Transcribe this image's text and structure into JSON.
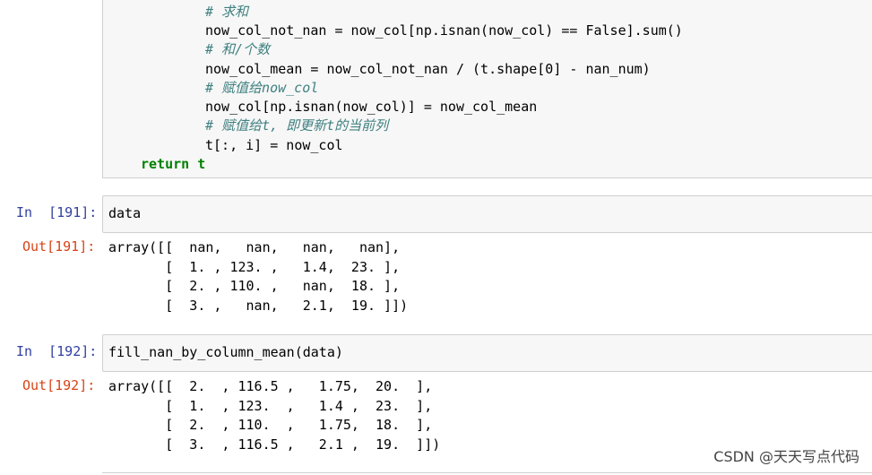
{
  "code_cell_190": {
    "lines": [
      {
        "type": "comment",
        "text": "# 求和"
      },
      {
        "type": "code",
        "text": "now_col_not_nan = now_col[np.isnan(now_col) == False].sum()"
      },
      {
        "type": "comment",
        "text": "# 和/个数"
      },
      {
        "type": "code",
        "text": "now_col_mean = now_col_not_nan / (t.shape[0] - nan_num)"
      },
      {
        "type": "comment",
        "text": "# 赋值给now_col"
      },
      {
        "type": "code",
        "text": "now_col[np.isnan(now_col)] = now_col_mean"
      },
      {
        "type": "comment",
        "text": "# 赋值给t, 即更新t的当前列"
      },
      {
        "type": "code",
        "text": "t[:, i] = now_col"
      },
      {
        "type": "return",
        "text": "return t"
      }
    ]
  },
  "cell_191": {
    "in_prompt": "In  [191]:",
    "input": "data",
    "out_prompt": "Out[191]:",
    "output_lines": [
      "array([[  nan,   nan,   nan,   nan],",
      "       [  1. , 123. ,   1.4,  23. ],",
      "       [  2. , 110. ,   nan,  18. ],",
      "       [  3. ,   nan,   2.1,  19. ]])"
    ]
  },
  "cell_192": {
    "in_prompt": "In  [192]:",
    "input": "fill_nan_by_column_mean(data)",
    "out_prompt": "Out[192]:",
    "output_lines": [
      "array([[  2.  , 116.5 ,   1.75,  20.  ],",
      "       [  1.  , 123.  ,   1.4 ,  23.  ],",
      "       [  2.  , 110.  ,   1.75,  18.  ],",
      "       [  3.  , 116.5 ,   2.1 ,  19.  ]])"
    ]
  },
  "watermark": "CSDN @天天写点代码"
}
